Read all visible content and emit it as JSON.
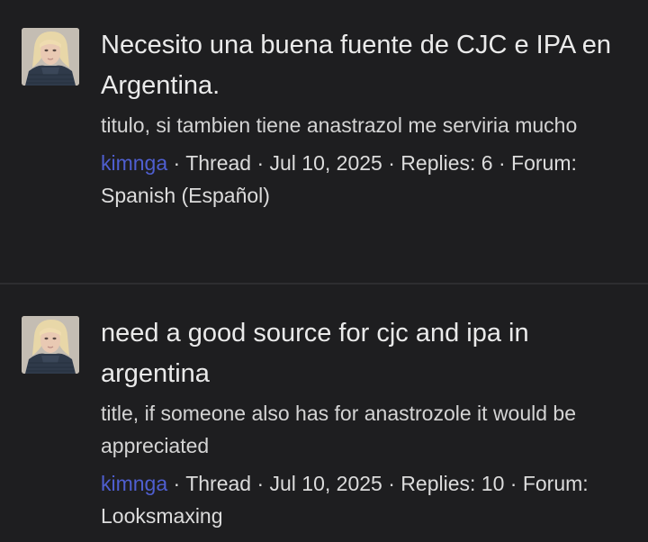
{
  "results": [
    {
      "title": "Necesito una buena fuente de CJC e IPA en Argentina.",
      "snippet": "titulo, si tambien tiene anastrazol me serviria mucho",
      "author": "kimnga",
      "type": "Thread",
      "date": "Jul 10, 2025",
      "replies_label": "Replies: 6",
      "forum_label": "Forum:",
      "forum": "Spanish (Español)",
      "separator": " · "
    },
    {
      "title": "need a good source for cjc and ipa in argentina",
      "snippet": "title, if someone also has for anastrozole it would be appreciated",
      "author": "kimnga",
      "type": "Thread",
      "date": "Jul 10, 2025",
      "replies_label": "Replies: 10",
      "forum_label": "Forum:",
      "forum": "Looksmaxing",
      "separator": " · "
    }
  ],
  "colors": {
    "background": "#1e1e20",
    "author_link": "#4f5fd1",
    "divider": "#2d2d30",
    "text": "#e6e6e6"
  }
}
